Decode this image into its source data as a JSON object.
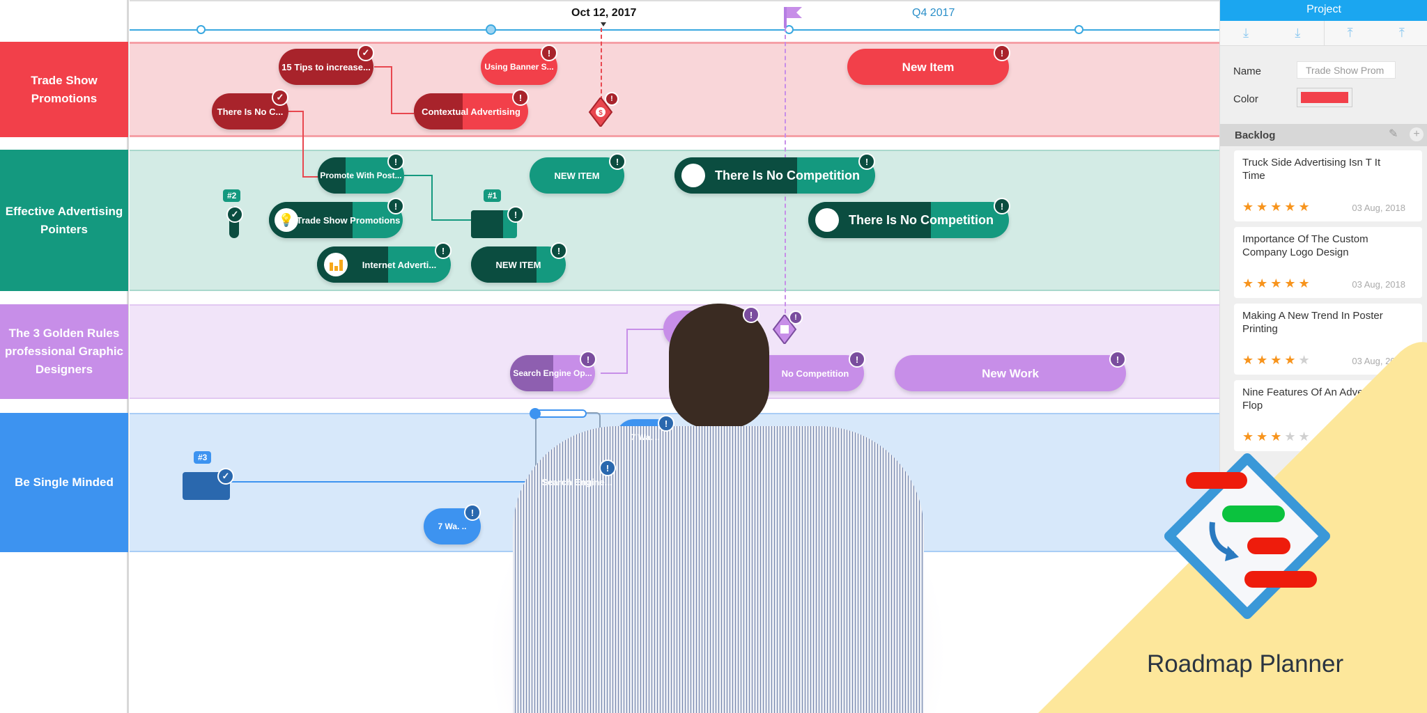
{
  "timeline": {
    "date_label": "Oct 12, 2017",
    "quarter_label": "Q4 2017"
  },
  "lanes": [
    {
      "label": "Trade Show Promotions",
      "color": "#f2404a"
    },
    {
      "label": "Effective Advertising Pointers",
      "color": "#14997f"
    },
    {
      "label": "The 3 Golden Rules professional Graphic Designers",
      "color": "#c78ee8"
    },
    {
      "label": "Be Single Minded",
      "color": "#3d93f0"
    }
  ],
  "items": {
    "tips": "15 Tips to increase...",
    "banner": "Using Banner S...",
    "new_item_red": "New Item",
    "there_is_no_c": "There Is No C...",
    "contextual": "Contextual Advertising",
    "promote": "Promote With Post...",
    "new_item_green_1": "NEW ITEM",
    "no_comp_1": "There Is No Competition",
    "no_comp_2": "There Is No Competition",
    "trade_show": "Trade Show Promotions",
    "internet": "Internet Adverti...",
    "new_item_green_2": "NEW ITEM",
    "search_engine_op": "Search Engine Op...",
    "no_comp_purple": "No Competition",
    "new_work": "New Work",
    "search_engine_blue": "Search Engine...",
    "seven_wa_1": "7 Wa. ..",
    "seven_wa_2": "7 Wa. .."
  },
  "tags": {
    "t1": "#1",
    "t2": "#2",
    "t3": "#3"
  },
  "badges": {
    "alert": "!",
    "check": "✓"
  },
  "panel": {
    "header": "Project",
    "name_label": "Name",
    "name_value": "Trade Show Prom",
    "color_label": "Color",
    "color_value": "#f2404a",
    "backlog_label": "Backlog",
    "cards": [
      {
        "title": "Truck Side Advertising Isn T It Time",
        "rating": 5,
        "stars": "★★★★★",
        "date": "03 Aug, 2018"
      },
      {
        "title": "Importance Of The Custom Company Logo Design",
        "rating": 5,
        "stars": "★★★★★",
        "date": "03 Aug, 2018"
      },
      {
        "title": "Making A New Trend In Poster Printing",
        "rating": 4,
        "stars": "★★★★",
        "empty": "★",
        "date": "03 Aug, 2018"
      },
      {
        "title": "Nine Features Of An Advertising Flop",
        "rating": 3,
        "stars": "★★★",
        "empty": "★★",
        "date": ""
      }
    ]
  },
  "branding": {
    "app_name": "Roadmap Planner"
  }
}
